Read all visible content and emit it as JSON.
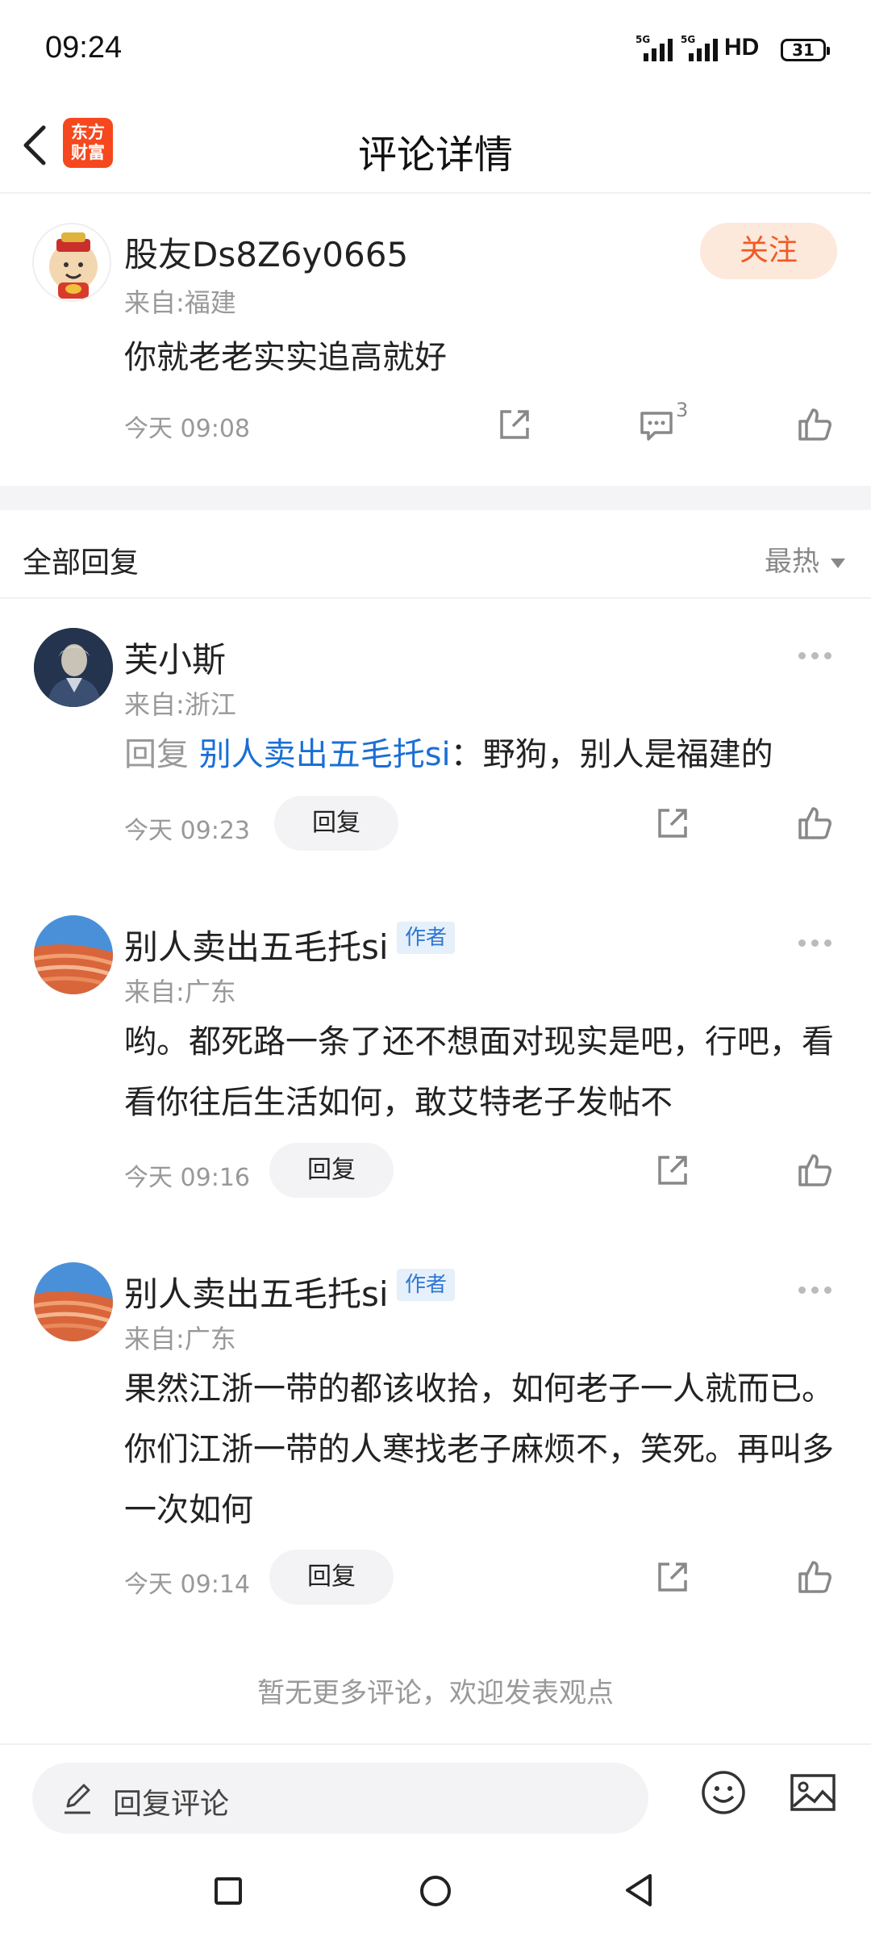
{
  "status_bar": {
    "time": "09:24",
    "signal1": "5G",
    "signal2": "5G",
    "hd": "HD",
    "battery": "31"
  },
  "header": {
    "logo_line1": "东方",
    "logo_line2": "财富",
    "title": "评论详情"
  },
  "main_comment": {
    "username": "股友Ds8Z6y0665",
    "location": "来自:福建",
    "text": "你就老老实实追高就好",
    "time": "今天 09:08",
    "follow_label": "关注",
    "reply_count": "3"
  },
  "filter": {
    "label": "全部回复",
    "sort_label": "最热"
  },
  "replies": [
    {
      "username": "芙小斯",
      "location": "来自:浙江",
      "reply_prefix": "回复 ",
      "reply_target": "别人卖出五毛托si",
      "text": "：野狗，别人是福建的",
      "time": "今天 09:23",
      "reply_label": "回复"
    },
    {
      "username": "别人卖出五毛托si",
      "badge": "作者",
      "location": "来自:广东",
      "text": "哟。都死路一条了还不想面对现实是吧，行吧，看看你往后生活如何，敢艾特老子发帖不",
      "time": "今天 09:16",
      "reply_label": "回复"
    },
    {
      "username": "别人卖出五毛托si",
      "badge": "作者",
      "location": "来自:广东",
      "text": "果然江浙一带的都该收拾，如何老子一人就而已。你们江浙一带的人寒找老子麻烦不，笑死。再叫多一次如何",
      "time": "今天 09:14",
      "reply_label": "回复"
    }
  ],
  "no_more": "暂无更多评论，欢迎发表观点",
  "bottom_bar": {
    "placeholder": "回复评论"
  },
  "colors": {
    "accent": "#f15a22",
    "link": "#1a6fd6",
    "muted": "#999999"
  }
}
